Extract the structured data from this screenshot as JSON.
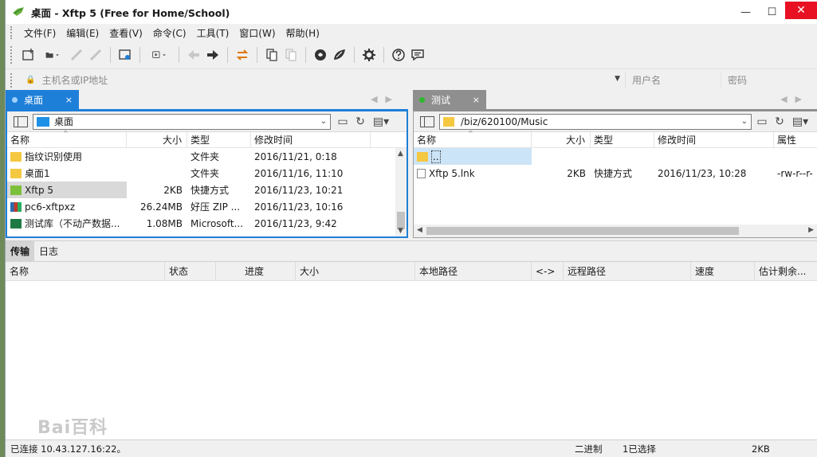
{
  "window": {
    "title": "桌面  - Xftp 5 (Free for Home/School)",
    "minimize": "—",
    "maximize": "☐",
    "close": "✕"
  },
  "menu": [
    "文件(F)",
    "编辑(E)",
    "查看(V)",
    "命令(C)",
    "工具(T)",
    "窗口(W)",
    "帮助(H)"
  ],
  "address": {
    "host_placeholder": "主机名或IP地址",
    "username_placeholder": "用户名",
    "password_placeholder": "密码"
  },
  "left": {
    "tab_label": "桌面",
    "tab_close": "×",
    "path": "桌面",
    "columns": [
      "名称",
      "大小",
      "类型",
      "修改时间"
    ],
    "files": [
      {
        "name": "指纹识别使用",
        "size": "",
        "type": "文件夹",
        "modified": "2016/11/21, 0:18",
        "icon": "folder-icon"
      },
      {
        "name": "桌面1",
        "size": "",
        "type": "文件夹",
        "modified": "2016/11/16, 11:10",
        "icon": "folder-icon"
      },
      {
        "name": "Xftp 5",
        "size": "2KB",
        "type": "快捷方式",
        "modified": "2016/11/23, 10:21",
        "icon": "xftp-shortcut-icon"
      },
      {
        "name": "pc6-xftpxz",
        "size": "26.24MB",
        "type": "好压 ZIP ...",
        "modified": "2016/11/23, 10:16",
        "icon": "archive-icon"
      },
      {
        "name": "测试库（不动产数据...",
        "size": "1.08MB",
        "type": "Microsoft...",
        "modified": "2016/11/23, 9:42",
        "icon": "excel-icon"
      }
    ]
  },
  "right": {
    "tab_label": "测试",
    "tab_close": "×",
    "path": "/biz/620100/Music",
    "columns": [
      "名称",
      "大小",
      "类型",
      "修改时间",
      "属性"
    ],
    "files": [
      {
        "name": "..",
        "size": "",
        "type": "",
        "modified": "",
        "attr": "",
        "icon": "folder-icon"
      },
      {
        "name": "Xftp 5.lnk",
        "size": "2KB",
        "type": "快捷方式",
        "modified": "2016/11/23, 10:28",
        "attr": "-rw-r--r-",
        "icon": "file-icon"
      }
    ]
  },
  "transfer": {
    "tabs": [
      "传输",
      "日志"
    ],
    "columns": [
      "名称",
      "状态",
      "进度",
      "大小",
      "本地路径",
      "<->",
      "远程路径",
      "速度",
      "估计剩余..."
    ]
  },
  "watermark": "Bai百科",
  "status": {
    "connection": "已连接 10.43.127.16:22。",
    "mode": "二进制",
    "selection": "1已选择",
    "size": "2KB"
  },
  "colors": {
    "accent": "#1e7fd8",
    "close": "#e81123",
    "connected": "#2eb82e"
  }
}
